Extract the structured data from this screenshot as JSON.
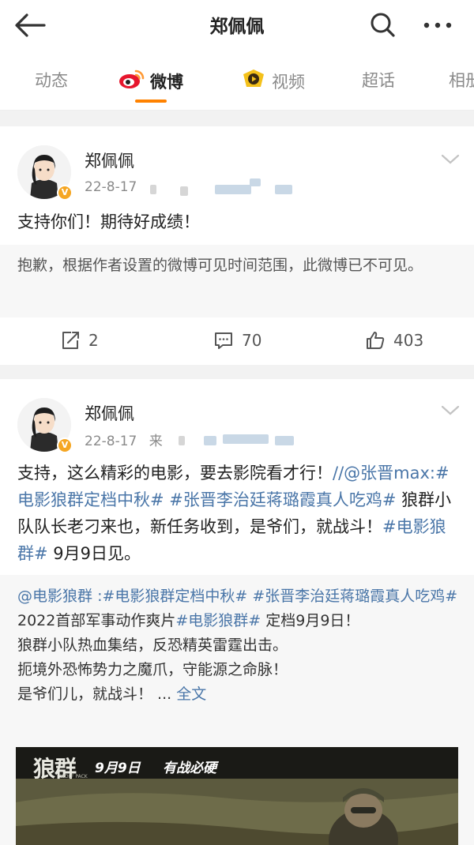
{
  "header": {
    "title": "郑佩佩"
  },
  "tabs": [
    {
      "label": "动态",
      "active": false
    },
    {
      "label": "微博",
      "active": true
    },
    {
      "label": "视频",
      "active": false
    },
    {
      "label": "超话",
      "active": false
    },
    {
      "label": "相册",
      "active": false
    }
  ],
  "colors": {
    "accent": "#ff8200",
    "link": "#4a76a8",
    "verified_badge": "#f5a623"
  },
  "posts": [
    {
      "author": "郑佩佩",
      "time": "22-8-17",
      "text": "支持你们！期待好成绩！",
      "notice": "抱歉，根据作者设置的微博可见时间范围，此微博已不可见。",
      "reposts": "2",
      "comments": "70",
      "likes": "403"
    },
    {
      "author": "郑佩佩",
      "time": "22-8-17",
      "source_prefix": "来",
      "text_parts": [
        "支持，这么精彩的电影，要去影院看才行！",
        "//@张晋max:",
        "#电影狼群定档中秋#",
        " ",
        "#张晋李治廷蒋璐霞真人吃鸡#",
        " 狼群小队队长老刁来也，新任务收到，是爷们，就战斗！",
        "#电影狼群#",
        " 9月9日见。"
      ],
      "repost": {
        "author_mention": "@电影狼群",
        "topic1": ":#电影狼群定档中秋#",
        "topic2": "#张晋李治廷蒋璐霞真人吃鸡#",
        "line1_prefix": "2022首部军事动作爽片",
        "line1_topic": "#电影狼群#",
        "line1_suffix": " 定档9月9日！",
        "line2": "狼群小队热血集结，反恐精英雷霆出击。",
        "line3": "扼境外恐怖势力之魔爪，守能源之命脉！",
        "line4": "是爷们儿，就战斗！ ... ",
        "full_text_link": "全文"
      },
      "video": {
        "logo_text": "狼群",
        "logo_sub": "WOLF PACK",
        "date_text": "9月9日",
        "slogan": "有战必硬"
      }
    }
  ]
}
